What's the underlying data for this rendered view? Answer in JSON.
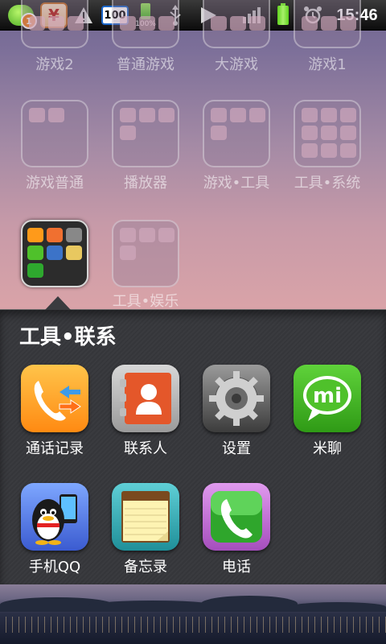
{
  "status_bar": {
    "qq_badge": "1",
    "yen": "¥",
    "box_value": "100",
    "battery_small_pct": "100%",
    "time": "15:46",
    "icons": [
      "qq-icon",
      "yen-app-icon",
      "warning-icon",
      "number-100-icon",
      "battery-small-icon",
      "usb-icon",
      "play-icon",
      "signal-icon",
      "battery-icon",
      "alarm-icon"
    ]
  },
  "home_folders": [
    {
      "label": "游戏2"
    },
    {
      "label": "普通游戏"
    },
    {
      "label": "大游戏"
    },
    {
      "label": "游戏1"
    },
    {
      "label": "游戏普通"
    },
    {
      "label": "播放器"
    },
    {
      "label": "游戏•工具"
    },
    {
      "label": "工具•系统"
    },
    {
      "label": "工具•娱乐"
    }
  ],
  "open_folder": {
    "title": "工具•联系",
    "apps": [
      {
        "label": "通话记录",
        "icon": "call-log-icon"
      },
      {
        "label": "联系人",
        "icon": "contacts-icon"
      },
      {
        "label": "设置",
        "icon": "settings-icon"
      },
      {
        "label": "米聊",
        "icon": "miliao-icon",
        "icon_text": "mi"
      },
      {
        "label": "手机QQ",
        "icon": "mobile-qq-icon"
      },
      {
        "label": "备忘录",
        "icon": "notes-icon"
      },
      {
        "label": "电话",
        "icon": "phone-icon"
      }
    ]
  },
  "colors": {
    "panel": "#3a3b3f",
    "status_bar": "#0c0c0c",
    "miliao_green": "#4fc12b",
    "call_log_orange": "#ff9a1a",
    "phone_purple": "#c070d0"
  }
}
